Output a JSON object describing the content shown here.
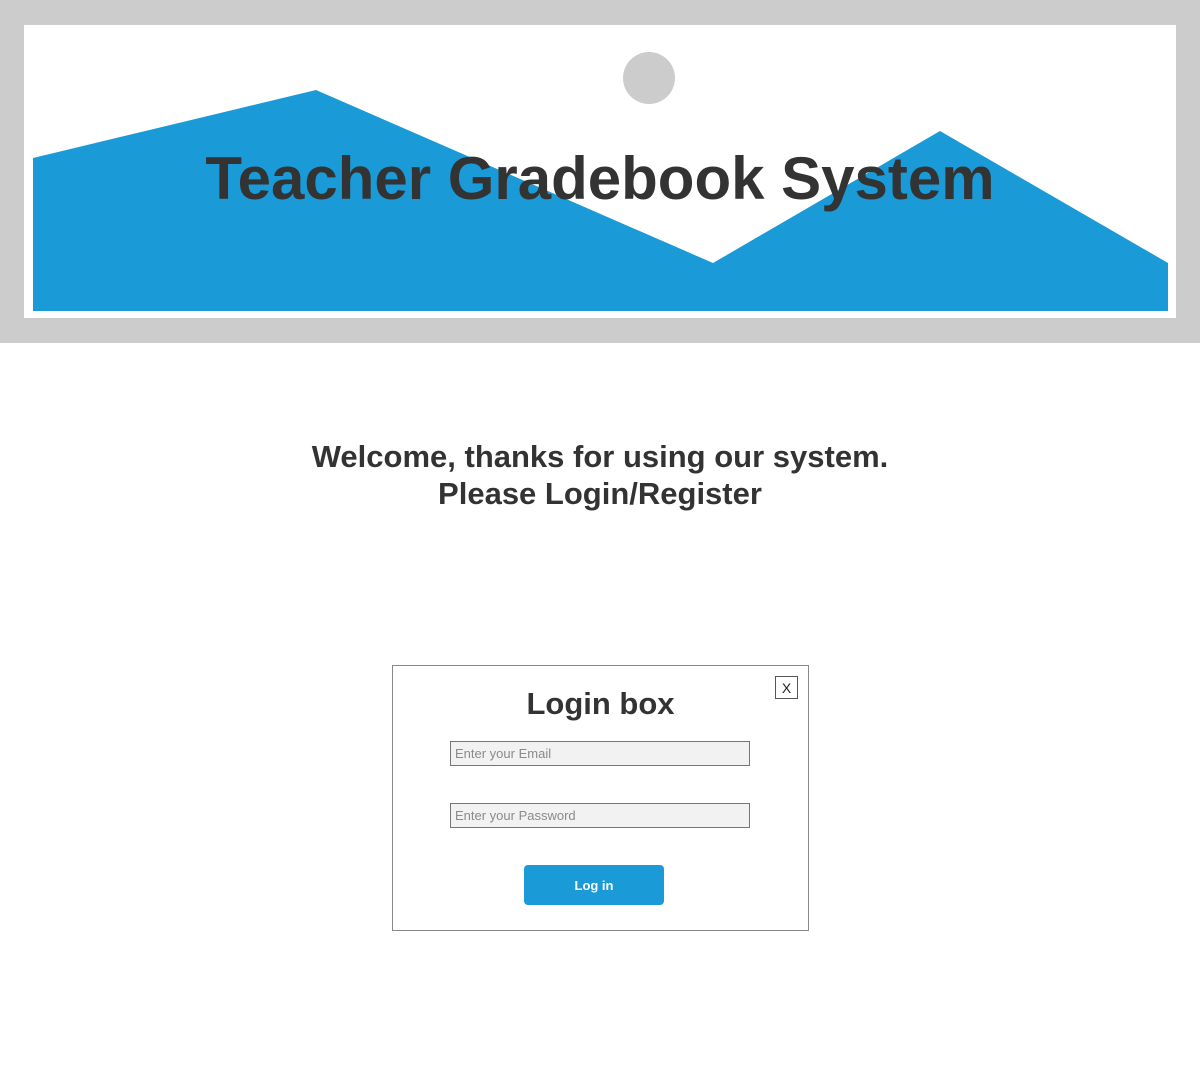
{
  "header": {
    "title": "Teacher Gradebook System",
    "banner_colors": {
      "frame": "#cccccc",
      "background": "#ffffff",
      "mountains": "#1a9ad6",
      "sun": "#cccccc"
    }
  },
  "welcome": {
    "line1": "Welcome, thanks for using our system.",
    "line2": "Please Login/Register"
  },
  "login_box": {
    "title": "Login box",
    "close_label": "X",
    "email_placeholder": "Enter your Email",
    "email_value": "",
    "password_placeholder": "Enter your Password",
    "password_value": "",
    "login_label": "Log in",
    "accent_color": "#1a9ad6"
  }
}
